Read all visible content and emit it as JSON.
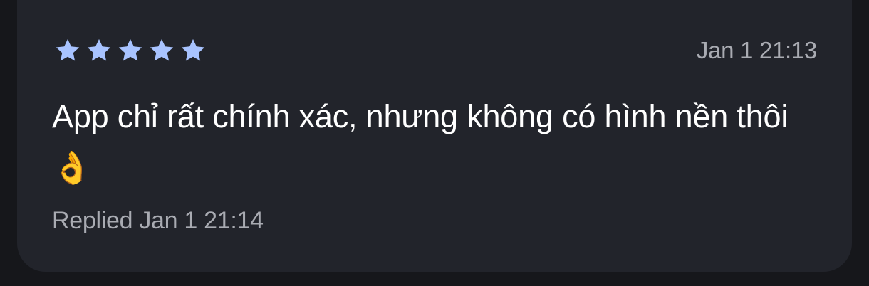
{
  "review": {
    "rating": 5,
    "max_rating": 5,
    "star_color": "#a8c3ff",
    "date": "Jan 1 21:13",
    "text": "App chỉ rất chính xác, nhưng không có hình nền thôi👌",
    "reply_status": "Replied Jan 1 21:14"
  },
  "icons": {
    "star": "star-icon"
  }
}
